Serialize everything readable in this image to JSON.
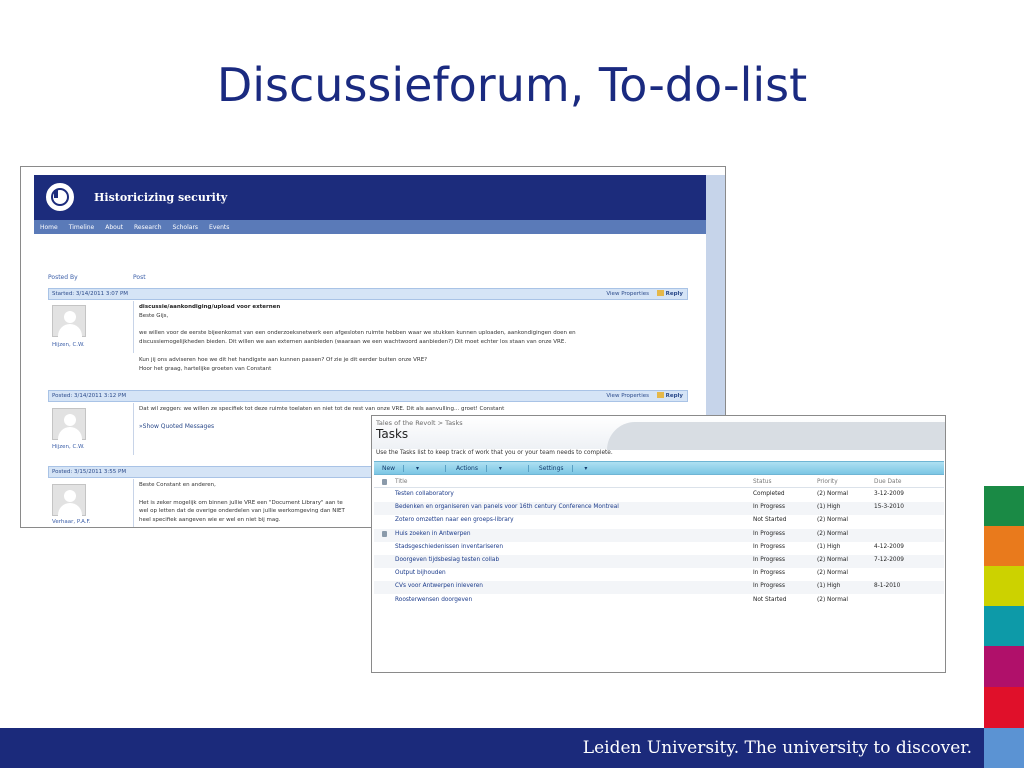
{
  "slide": {
    "title": "Discussieforum, To-do-list",
    "footer": "Leiden University. The university to discover."
  },
  "accent_colors": [
    "#1a8a45",
    "#e97a1c",
    "#ccd200",
    "#0d9aa8",
    "#b0106a",
    "#e0102a",
    "#5b93d3"
  ],
  "forum": {
    "site_title": "Historicizing security",
    "nav": [
      "Home",
      "Timeline",
      "About",
      "Research",
      "Scholars",
      "Events"
    ],
    "col_posted_by": "Posted By",
    "col_post": "Post",
    "view_properties": "View Properties",
    "reply": "Reply",
    "show_quoted": "Show Quoted Messages",
    "posts": [
      {
        "header": "Started: 3/14/2011 3:07 PM",
        "author": "Hijzen, C.W.",
        "subject": "discussie/aankondiging/upload voor externen",
        "lines": [
          "Beste Gijs,",
          "",
          "we willen voor de eerste bijeenkomst van een onderzoeksnetwerk een afgesloten ruimte hebben waar we stukken kunnen uploaden, aankondigingen doen en",
          "discussiemogelijkheden bieden. Dit willen we aan externen aanbieden (waaraan we een wachtwoord aanbieden?) Dit moet echter los staan van onze VRE.",
          "",
          "Kun jij ons adviseren hoe we dit het handigste aan kunnen passen? Of zie je dit eerder buiten onze VRE?",
          "Hoor het graag, hartelijke groeten van Constant"
        ]
      },
      {
        "header": "Posted: 3/14/2011 3:12 PM",
        "author": "Hijzen, C.W.",
        "lines": [
          "Dat wil zeggen: we willen ze specifiek tot deze ruimte toelaten en niet tot de rest van onze VRE. Dit als aanvulling... groet! Constant"
        ]
      },
      {
        "header": "Posted: 3/15/2011 3:55 PM",
        "author": "Verhaar, P.A.F.",
        "lines": [
          "Beste Constant en anderen,",
          "",
          "Het is zeker mogelijk om binnen jullie VRE een \"Document Library\" aan te",
          "wel op letten dat de overige onderdelen van jullie werkomgeving dan NIET",
          "heel specifiek aangeven wie er wel en niet bij mag."
        ]
      }
    ]
  },
  "tasks": {
    "breadcrumb": "Tales of the Revolt > Tasks",
    "title": "Tasks",
    "description": "Use the Tasks list to keep track of work that you or your team needs to complete.",
    "toolbar": [
      "New",
      "Actions",
      "Settings"
    ],
    "columns": {
      "title": "Title",
      "status": "Status",
      "priority": "Priority",
      "due": "Due Date"
    },
    "rows": [
      {
        "title": "Testen collaboratory",
        "status": "Completed",
        "priority": "(2) Normal",
        "due": "3-12-2009",
        "icon": false
      },
      {
        "title": "Bedenken en organiseren van panels voor 16th century Conference Montreal",
        "status": "In Progress",
        "priority": "(1) High",
        "due": "15-3-2010",
        "icon": false
      },
      {
        "title": "Zotero omzetten naar een groeps-library",
        "status": "Not Started",
        "priority": "(2) Normal",
        "due": "",
        "icon": false
      },
      {
        "title": "Huis zoeken in Antwerpen",
        "status": "In Progress",
        "priority": "(2) Normal",
        "due": "",
        "icon": true
      },
      {
        "title": "Stadsgeschiedenissen inventariseren",
        "status": "In Progress",
        "priority": "(1) High",
        "due": "4-12-2009",
        "icon": false
      },
      {
        "title": "Doorgeven tijdsbeslag testen collab",
        "status": "In Progress",
        "priority": "(2) Normal",
        "due": "7-12-2009",
        "icon": false
      },
      {
        "title": "Output bijhouden",
        "status": "In Progress",
        "priority": "(2) Normal",
        "due": "",
        "icon": false
      },
      {
        "title": "CVs voor Antwerpen inleveren",
        "status": "In Progress",
        "priority": "(1) High",
        "due": "8-1-2010",
        "icon": false
      },
      {
        "title": "Roosterwensen doorgeven",
        "status": "Not Started",
        "priority": "(2) Normal",
        "due": "",
        "icon": false
      }
    ]
  }
}
